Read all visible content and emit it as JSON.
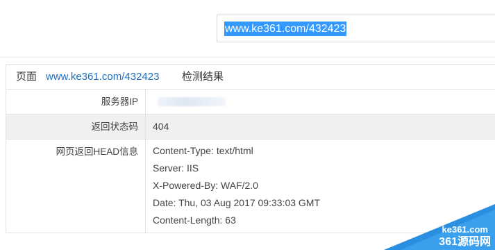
{
  "search": {
    "url_value": "www.ke361.com/432423"
  },
  "result": {
    "title_prefix": "页面",
    "title_url": "www.ke361.com/432423",
    "title_suffix": "检测结果",
    "rows": [
      {
        "label": "服务器IP",
        "value": ""
      },
      {
        "label": "返回状态码",
        "value": "404"
      },
      {
        "label": "网页返回HEAD信息",
        "headers": [
          "Content-Type: text/html",
          "Server: IIS",
          "X-Powered-By: WAF/2.0",
          "Date: Thu, 03 Aug 2017 09:33:03 GMT",
          "Content-Length: 63"
        ]
      }
    ]
  },
  "watermark": {
    "site": "ke361.com",
    "brand": "361源码网"
  },
  "colors": {
    "accent": "#3399ff",
    "link": "#1e6fbf",
    "row_shade": "#f0f0f0",
    "watermark": "#2a8fe0"
  }
}
